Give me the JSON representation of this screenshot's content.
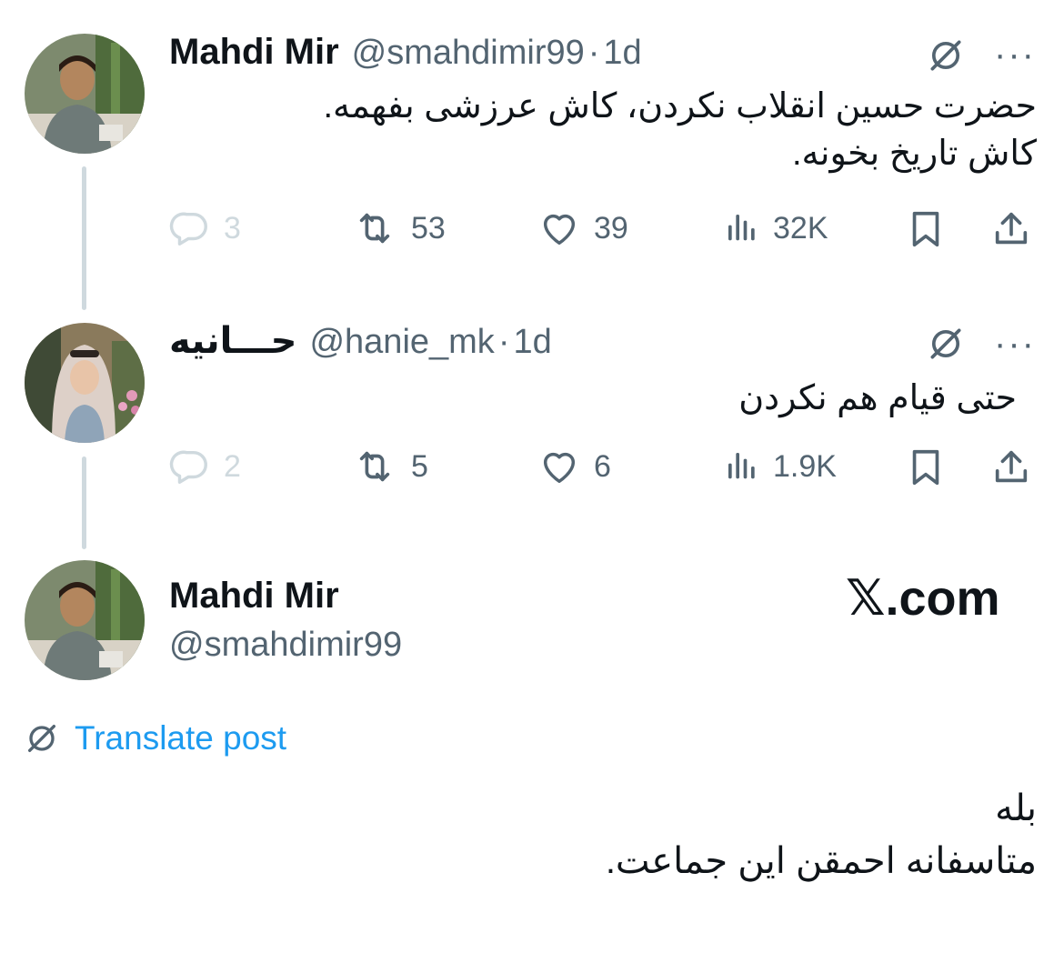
{
  "tweets": [
    {
      "name": "Mahdi Mir",
      "handle": "@smahdimir99",
      "time": "1d",
      "text_lines": [
        "حضرت حسین انقلاب نکردن، کاش عرزشی بفهمه.",
        "کاش تاریخ بخونه."
      ],
      "replies": "3",
      "reposts": "53",
      "likes": "39",
      "views": "32K"
    },
    {
      "name": "حـــانیه",
      "handle": "@hanie_mk",
      "time": "1d",
      "text_lines": [
        "حتی قیام هم نکردن"
      ],
      "replies": "2",
      "reposts": "5",
      "likes": "6",
      "views": "1.9K"
    }
  ],
  "main": {
    "name": "Mahdi Mir",
    "handle": "@smahdimir99",
    "watermark": "𝕏.com",
    "translate_label": "Translate post",
    "text_lines": [
      "بله",
      "متاسفانه احمقن این جماعت."
    ]
  },
  "separator": "·",
  "more_glyph": "···",
  "icons": [
    "grok-icon",
    "more-icon",
    "reply-icon",
    "repost-icon",
    "like-icon",
    "views-icon",
    "bookmark-icon",
    "share-icon",
    "translate-icon"
  ],
  "colors": {
    "text": "#0f1419",
    "secondary": "#536471",
    "muted": "#cfd9de",
    "link": "#1d9bf0"
  }
}
